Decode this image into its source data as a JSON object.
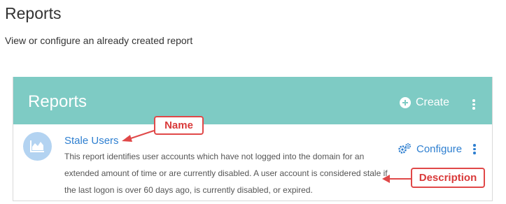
{
  "page": {
    "title": "Reports",
    "subtitle": "View or configure an already created report"
  },
  "card": {
    "title": "Reports",
    "create_label": "Create",
    "header_color": "#7ecbc4",
    "report": {
      "name": "Stale Users",
      "description": "This report identifies user accounts which have not logged into the domain for an extended amount of time or are currently disabled. A user account is considered stale if the last logon is over 60 days ago, is currently disabled, or expired.",
      "configure_label": "Configure",
      "icon": "area-chart-icon"
    }
  },
  "annotations": {
    "name_label": "Name",
    "description_label": "Description",
    "color": "#e04848"
  }
}
